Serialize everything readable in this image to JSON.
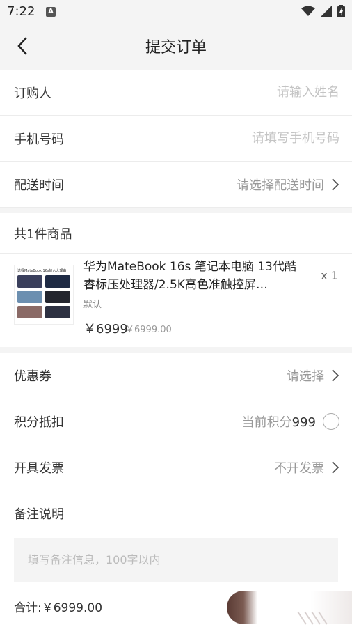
{
  "status_bar": {
    "time": "7:22",
    "a_icon": "A"
  },
  "header": {
    "title": "提交订单",
    "back_icon": "back-arrow-icon"
  },
  "form": {
    "buyer": {
      "label": "订购人",
      "placeholder": "请输入姓名"
    },
    "phone": {
      "label": "手机号码",
      "placeholder": "请填写手机号码"
    },
    "delivery": {
      "label": "配送时间",
      "value": "请选择配送时间"
    }
  },
  "items": {
    "count_label": "共1件商品",
    "product": {
      "name": "华为MateBook 16s 笔记本电脑 13代酷睿标压处理器/2.5K高色准触控屏…",
      "qty": "x 1",
      "spec": "默认",
      "price": "￥6999",
      "original_price": "￥6999.00",
      "image_caption": "选择MateBook 16s的六大理由"
    }
  },
  "options": {
    "coupon": {
      "label": "优惠券",
      "value": "请选择"
    },
    "points": {
      "label": "积分抵扣",
      "prefix": "当前积分",
      "value": "999"
    },
    "invoice": {
      "label": "开具发票",
      "value": "不开发票"
    }
  },
  "notes": {
    "label": "备注说明",
    "placeholder": "填写备注信息，100字以内"
  },
  "footer": {
    "total_label": "合计:",
    "total_value": "￥6999.00"
  }
}
